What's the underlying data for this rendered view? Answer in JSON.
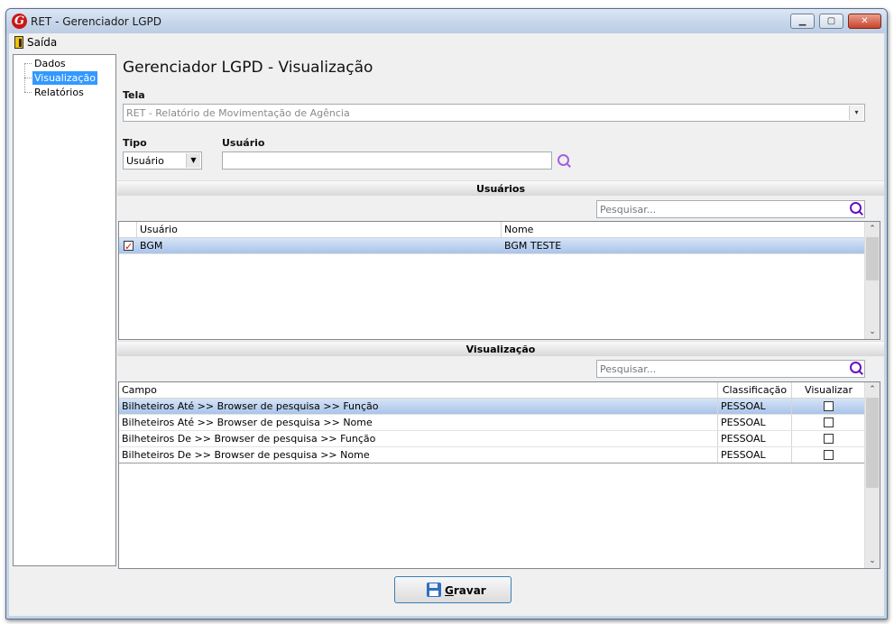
{
  "window": {
    "title": "RET - Gerenciador LGPD",
    "logo_letter": "G",
    "minimize_icon": "minimize-icon",
    "maximize_icon": "maximize-icon",
    "close_icon": "close-icon",
    "min_glyph": "▁",
    "max_glyph": "▢",
    "close_glyph": "✕"
  },
  "menu": {
    "exit_label": "Saída",
    "exit_icon": "exit-door-icon"
  },
  "tree": {
    "items": [
      {
        "label": "Dados"
      },
      {
        "label": "Visualização",
        "selected": true
      },
      {
        "label": "Relatórios"
      }
    ]
  },
  "page": {
    "title": "Gerenciador LGPD - Visualização"
  },
  "tela": {
    "label": "Tela",
    "value": "RET - Relatório de Movimentação de Agência"
  },
  "tipo": {
    "label": "Tipo",
    "value": "Usuário"
  },
  "usuario_field": {
    "label": "Usuário",
    "value": ""
  },
  "usuarios_section": {
    "title": "Usuários",
    "search_placeholder": "Pesquisar...",
    "columns": [
      "Usuário",
      "Nome"
    ],
    "rows": [
      {
        "checked": true,
        "usuario": "BGM",
        "nome": "BGM TESTE"
      }
    ]
  },
  "visualizacao_section": {
    "title": "Visualização",
    "search_placeholder": "Pesquisar...",
    "columns": [
      "Campo",
      "Classificação",
      "Visualizar"
    ],
    "rows": [
      {
        "campo": "Bilheteiros Até >> Browser de pesquisa >> Função",
        "classificacao": "PESSOAL",
        "visualizar": false
      },
      {
        "campo": "Bilheteiros Até >> Browser de pesquisa >> Nome",
        "classificacao": "PESSOAL",
        "visualizar": false
      },
      {
        "campo": "Bilheteiros De >> Browser de pesquisa >> Função",
        "classificacao": "PESSOAL",
        "visualizar": false
      },
      {
        "campo": "Bilheteiros De >> Browser de pesquisa >> Nome",
        "classificacao": "PESSOAL",
        "visualizar": false
      }
    ]
  },
  "footer": {
    "save_label_first": "G",
    "save_label_rest": "ravar",
    "save_icon": "floppy-disk-icon"
  },
  "glyphs": {
    "arrow_down": "▼",
    "arrow_disabled": "▾",
    "scroll_up": "⌃",
    "scroll_down": "⌄"
  },
  "colors": {
    "selection": "#3399ff",
    "title_bar": "#c6d6ea",
    "search_icon": "#6a0ec0"
  }
}
